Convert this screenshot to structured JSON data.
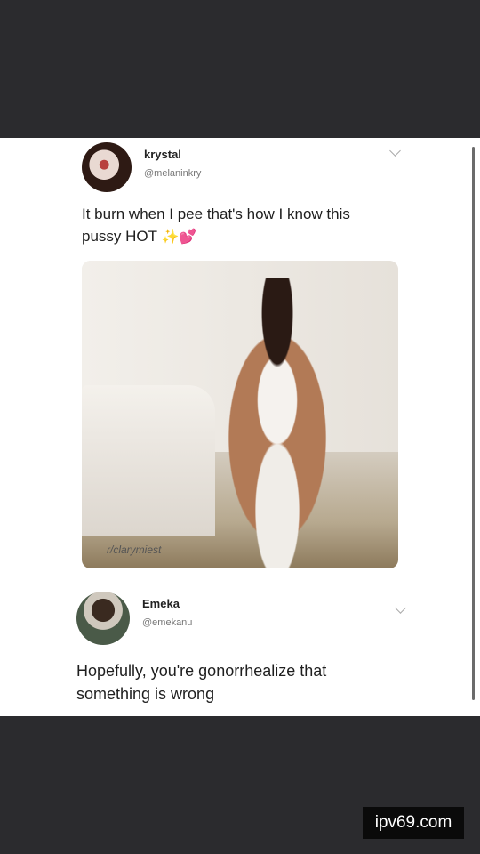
{
  "post1": {
    "display_name": "krystal",
    "handle": "@melaninkry",
    "text_line1": "It burn when I pee that's how I know this",
    "text_line2": "pussy HOT",
    "emoji": "✨💕",
    "photo_caption": "r/clarymiest"
  },
  "post2": {
    "display_name": "Emeka",
    "handle": "@emekanu",
    "text_line1": "Hopefully,  you're gonorrhealize that",
    "text_line2": "something is wrong"
  },
  "watermark": "ipv69.com",
  "colors": {
    "background": "#2b2b2e",
    "card": "#ffffff",
    "watermark_bg": "#0a0a0a"
  }
}
